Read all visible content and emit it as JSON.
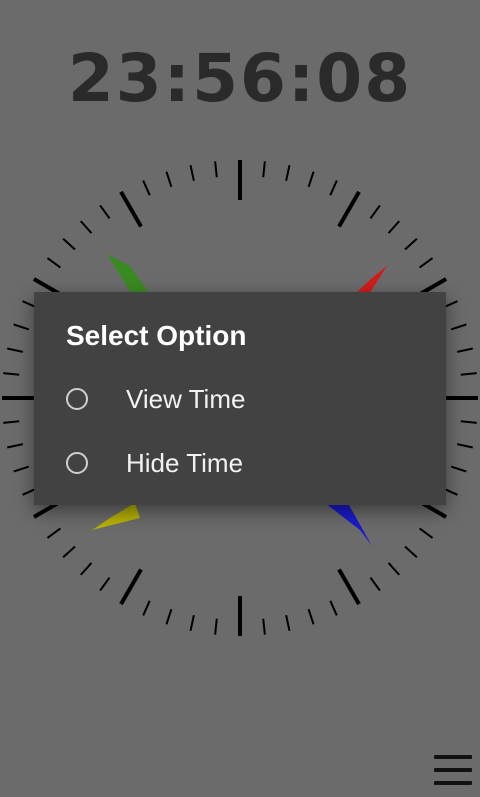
{
  "clock": {
    "digital_time": "23:56:08",
    "hands": [
      {
        "name": "hour-hand",
        "color": "#3a8a22"
      },
      {
        "name": "minute-hand",
        "color": "#d11c1c"
      },
      {
        "name": "second-hand",
        "color": "#c8c400"
      },
      {
        "name": "extra-hand",
        "color": "#1a1acd"
      }
    ]
  },
  "dialog": {
    "title": "Select Option",
    "options": [
      {
        "label": "View Time",
        "selected": false
      },
      {
        "label": "Hide Time",
        "selected": false
      }
    ]
  },
  "menu": {
    "icon": "hamburger-menu-icon"
  }
}
